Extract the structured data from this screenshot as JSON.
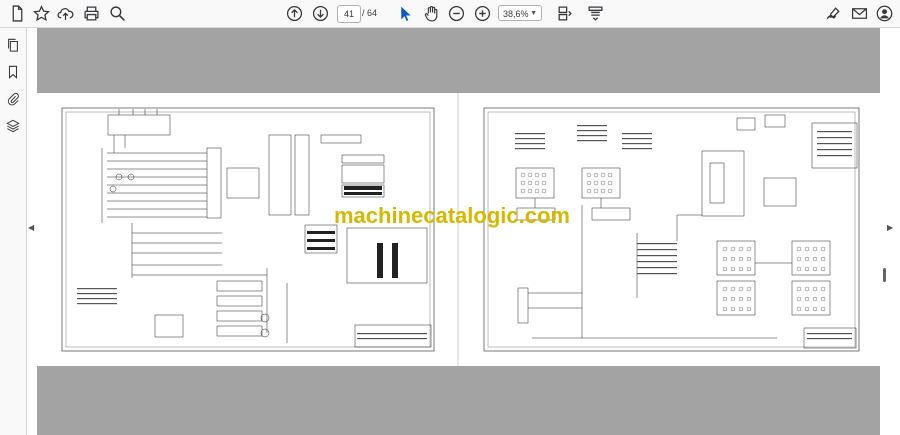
{
  "toolbar": {
    "page_current": "41",
    "page_total": "/ 64",
    "zoom": "38,6%"
  },
  "watermark": "machinecatalogic.com"
}
